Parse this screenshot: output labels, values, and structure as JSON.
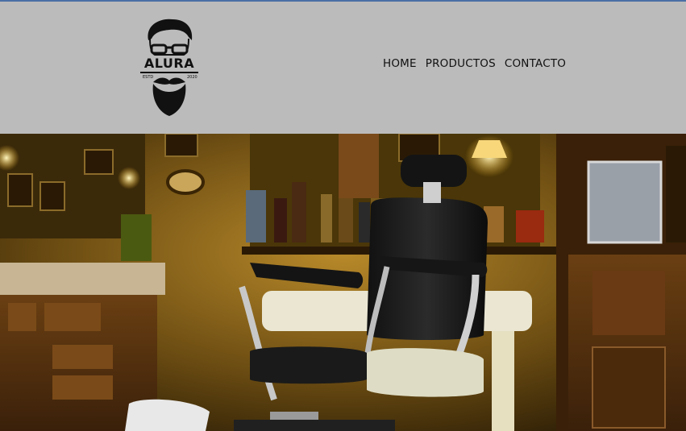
{
  "header": {
    "logo": {
      "brand": "ALURA",
      "estd": "ESTD",
      "year": "2020",
      "icon": "bearded-man-logo"
    },
    "nav": [
      {
        "label": "HOME"
      },
      {
        "label": "PRODUCTOS"
      },
      {
        "label": "CONTACTO"
      }
    ]
  },
  "hero": {
    "image": "barbershop-interior-photo"
  },
  "colors": {
    "header_bg": "#bbbbbb",
    "top_border": "#4a6fa5",
    "text": "#111111"
  }
}
